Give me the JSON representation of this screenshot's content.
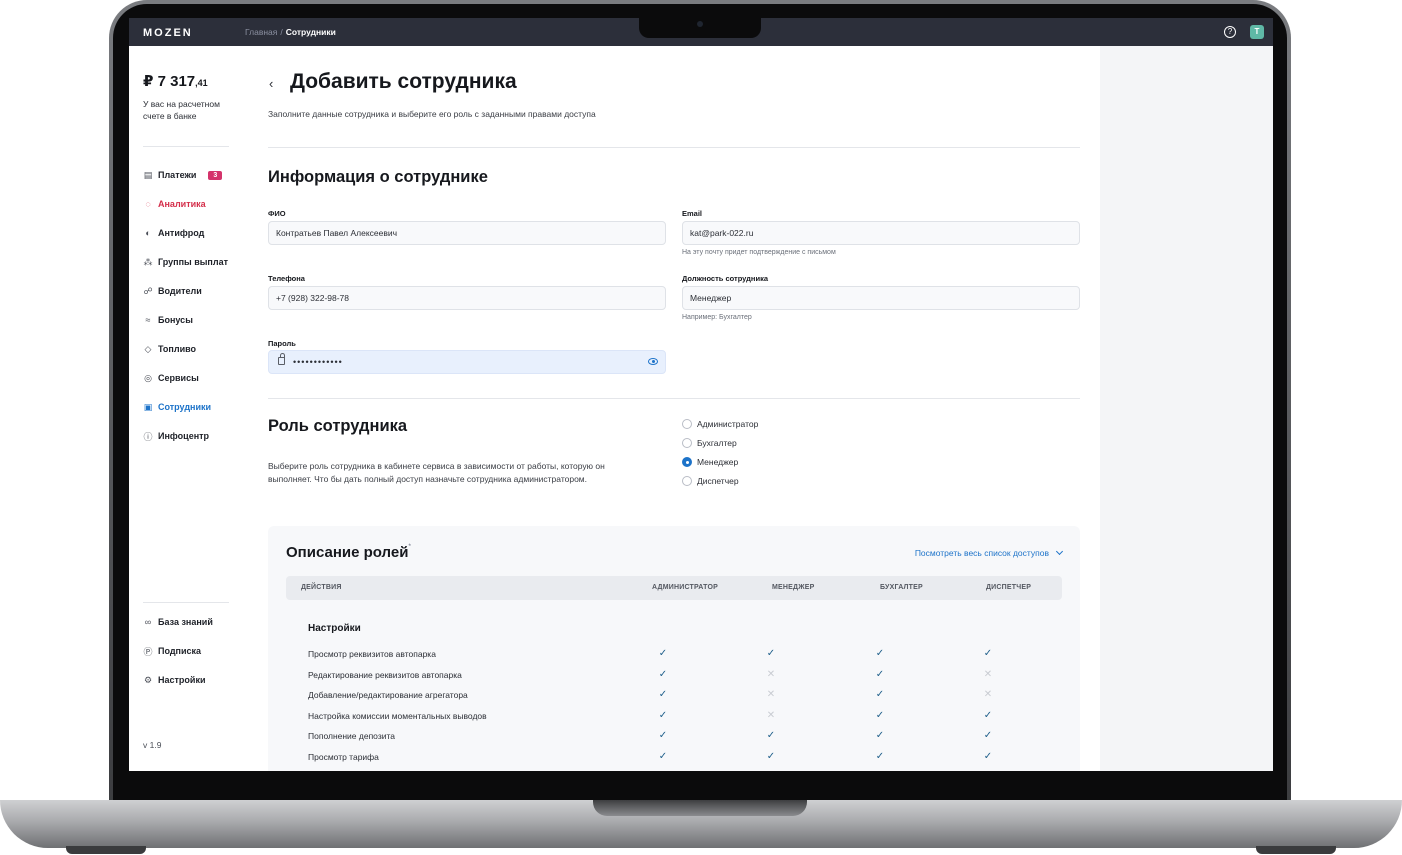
{
  "topbar": {
    "logo": "MOZEN",
    "breadcrumb_home": "Главная",
    "breadcrumb_sep": "/",
    "breadcrumb_current": "Сотрудники",
    "help_icon": "question-circle-icon",
    "avatar_initial": "T"
  },
  "sidebar": {
    "balance_main": "₽ 7 317",
    "balance_cents": ",41",
    "balance_note": "У вас на расчетном счете в банке",
    "items": [
      {
        "label": "Платежи",
        "icon": "database-icon",
        "glyph": "▤",
        "badge": "3"
      },
      {
        "label": "Аналитика",
        "icon": "analytics-icon",
        "glyph": "◌"
      },
      {
        "label": "Антифрод",
        "icon": "shield-icon",
        "glyph": "◐"
      },
      {
        "label": "Группы выплат",
        "icon": "grid-icon",
        "glyph": "⁂"
      },
      {
        "label": "Водители",
        "icon": "drivers-icon",
        "glyph": "☍"
      },
      {
        "label": "Бонусы",
        "icon": "bonus-icon",
        "glyph": "≈"
      },
      {
        "label": "Топливо",
        "icon": "fuel-drop-icon",
        "glyph": "◇"
      },
      {
        "label": "Сервисы",
        "icon": "services-icon",
        "glyph": "◎"
      },
      {
        "label": "Сотрудники",
        "icon": "employees-icon",
        "glyph": "▣"
      },
      {
        "label": "Инфоцентр",
        "icon": "info-icon",
        "glyph": "ⓘ"
      }
    ],
    "bottom_items": [
      {
        "label": "База знаний",
        "icon": "glasses-icon",
        "glyph": "∞"
      },
      {
        "label": "Подписка",
        "icon": "subscription-icon",
        "glyph": "Ⓟ"
      },
      {
        "label": "Настройки",
        "icon": "gear-icon",
        "glyph": "⚙"
      }
    ],
    "version": "v 1.9"
  },
  "page": {
    "title": "Добавить сотрудника",
    "subtitle": "Заполните данные сотрудника и выберите его роль с заданными правами доступа"
  },
  "form": {
    "section_title": "Информация о сотруднике",
    "fio_label": "ФИО",
    "fio_value": "Контратьев Павел Алексеевич",
    "email_label": "Email",
    "email_value": "kat@park-022.ru",
    "email_hint": "На эту почту придет подтверждение с письмом",
    "phone_label": "Телефона",
    "phone_value": "+7 (928) 322-98-78",
    "position_label": "Должность сотрудника",
    "position_value": "Менеджер",
    "position_hint": "Например: Бухгалтер",
    "password_label": "Пароль",
    "password_value": "••••••••••••"
  },
  "role": {
    "section_title": "Роль сотрудника",
    "description": "Выберите роль сотрудника в кабинете сервиса в зависимости от работы, которую он выполняет. Что бы дать полный доступ назначьте сотрудника администратором.",
    "options": [
      "Администратор",
      "Бухгалтер",
      "Менеджер",
      "Диспетчер"
    ],
    "selected": "Менеджер"
  },
  "roles_table": {
    "title": "Описание ролей",
    "title_mark": "*",
    "view_all": "Посмотреть весь список доступов",
    "headers": [
      "ДЕЙСТВИЯ",
      "АДМИНИСТРАТОР",
      "МЕНЕДЖЕР",
      "БУХГАЛТЕР",
      "ДИСПЕТЧЕР"
    ],
    "group": "Настройки",
    "rows": [
      {
        "action": "Просмотр реквизитов автопарка",
        "marks": [
          "✓",
          "✓",
          "✓",
          "✓"
        ]
      },
      {
        "action": "Редактирование реквизитов автопарка",
        "marks": [
          "✓",
          "✕",
          "✓",
          "✕"
        ]
      },
      {
        "action": "Добавление/редактирование агрегатора",
        "marks": [
          "✓",
          "✕",
          "✓",
          "✕"
        ]
      },
      {
        "action": "Настройка комиссии моментальных выводов",
        "marks": [
          "✓",
          "✕",
          "✓",
          "✓"
        ]
      },
      {
        "action": "Пополнение депозита",
        "marks": [
          "✓",
          "✓",
          "✓",
          "✓"
        ]
      },
      {
        "action": "Просмотр тарифа",
        "marks": [
          "✓",
          "✓",
          "✓",
          "✓"
        ]
      }
    ]
  }
}
